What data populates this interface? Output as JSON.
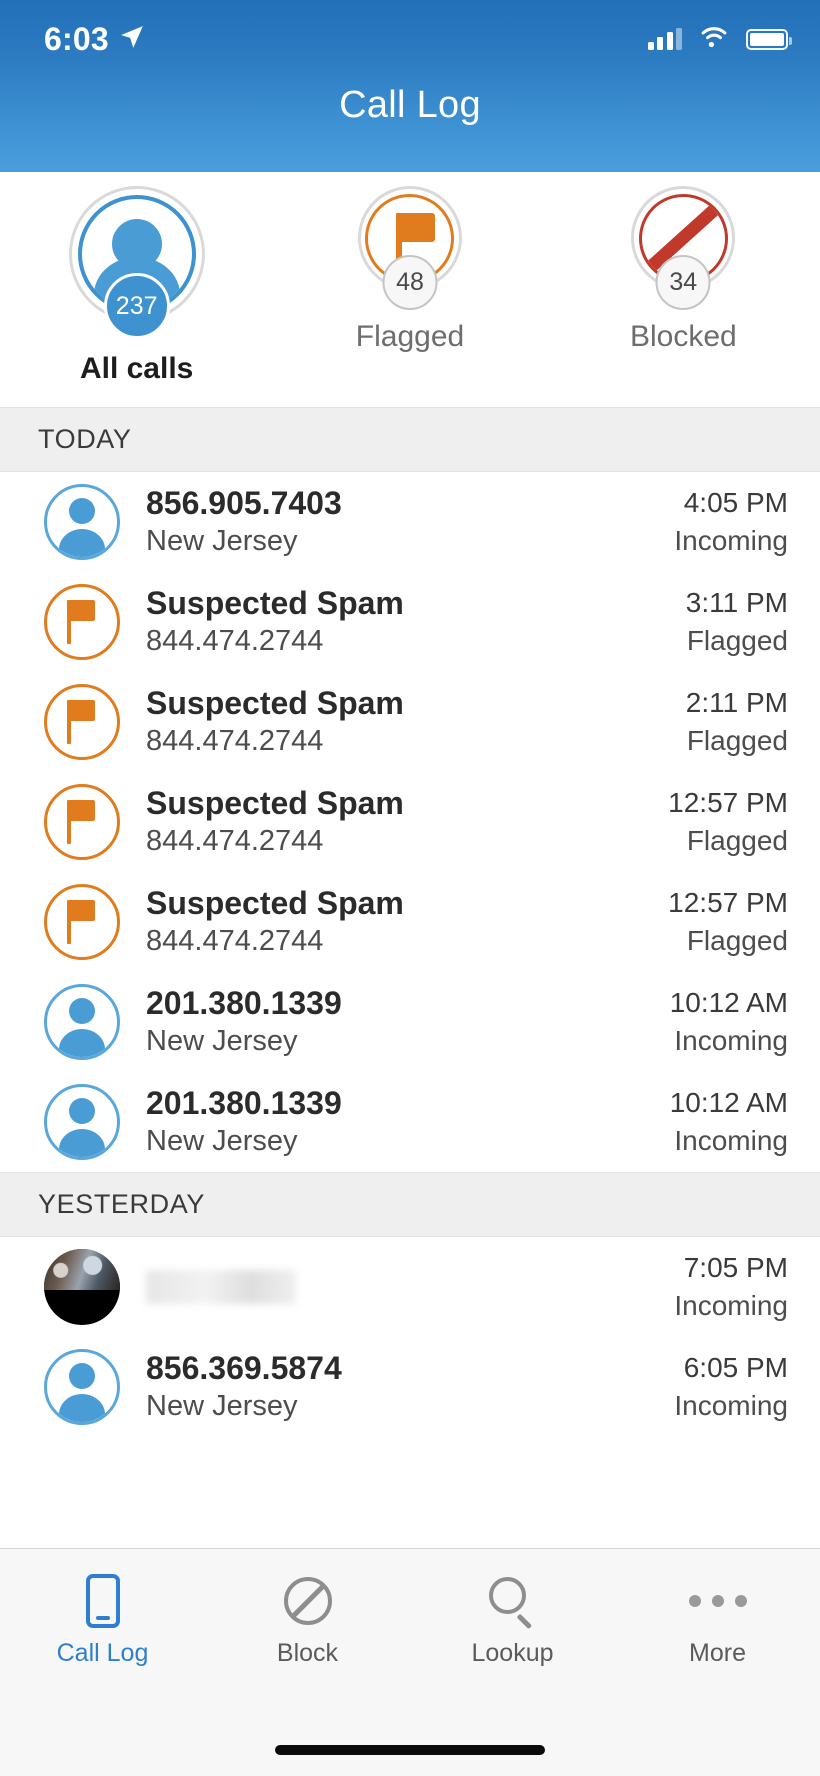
{
  "statusbar": {
    "time": "6:03",
    "location_icon": "location-arrow-icon",
    "signal_icon": "cellular-signal-icon",
    "wifi_icon": "wifi-icon",
    "battery_icon": "battery-icon"
  },
  "header": {
    "title": "Call Log"
  },
  "summary": [
    {
      "label": "All calls",
      "count": "237",
      "icon": "person-icon",
      "active": true,
      "accent": "#3d92cf"
    },
    {
      "label": "Flagged",
      "count": "48",
      "icon": "flag-icon",
      "active": false,
      "accent": "#e07c1e"
    },
    {
      "label": "Blocked",
      "count": "34",
      "icon": "block-circle-slash-icon",
      "active": false,
      "accent": "#c0392b"
    }
  ],
  "sections": [
    {
      "header": "TODAY",
      "rows": [
        {
          "avatar": "person-icon",
          "avatar_style": "blue",
          "title": "856.905.7403",
          "subtitle": "New Jersey",
          "time": "4:05 PM",
          "kind": "Incoming"
        },
        {
          "avatar": "flag-icon",
          "avatar_style": "orange",
          "title": "Suspected Spam",
          "subtitle": "844.474.2744",
          "time": "3:11 PM",
          "kind": "Flagged"
        },
        {
          "avatar": "flag-icon",
          "avatar_style": "orange",
          "title": "Suspected Spam",
          "subtitle": "844.474.2744",
          "time": "2:11 PM",
          "kind": "Flagged"
        },
        {
          "avatar": "flag-icon",
          "avatar_style": "orange",
          "title": "Suspected Spam",
          "subtitle": "844.474.2744",
          "time": "12:57 PM",
          "kind": "Flagged"
        },
        {
          "avatar": "flag-icon",
          "avatar_style": "orange",
          "title": "Suspected Spam",
          "subtitle": "844.474.2744",
          "time": "12:57 PM",
          "kind": "Flagged"
        },
        {
          "avatar": "person-icon",
          "avatar_style": "blue",
          "title": "201.380.1339",
          "subtitle": "New Jersey",
          "time": "10:12 AM",
          "kind": "Incoming"
        },
        {
          "avatar": "person-icon",
          "avatar_style": "blue",
          "title": "201.380.1339",
          "subtitle": "New Jersey",
          "time": "10:12 AM",
          "kind": "Incoming"
        }
      ]
    },
    {
      "header": "YESTERDAY",
      "rows": [
        {
          "avatar": "contact-photo-icon",
          "avatar_style": "photo",
          "title": "",
          "redacted": true,
          "subtitle": "",
          "time": "7:05 PM",
          "kind": "Incoming"
        },
        {
          "avatar": "person-icon",
          "avatar_style": "blue",
          "title": "856.369.5874",
          "subtitle": "New Jersey",
          "time": "6:05 PM",
          "kind": "Incoming"
        }
      ]
    }
  ],
  "tabbar": [
    {
      "label": "Call Log",
      "icon": "phone-icon",
      "active": true
    },
    {
      "label": "Block",
      "icon": "block-circle-slash-icon",
      "active": false
    },
    {
      "label": "Lookup",
      "icon": "search-icon",
      "active": false
    },
    {
      "label": "More",
      "icon": "ellipsis-icon",
      "active": false
    }
  ]
}
